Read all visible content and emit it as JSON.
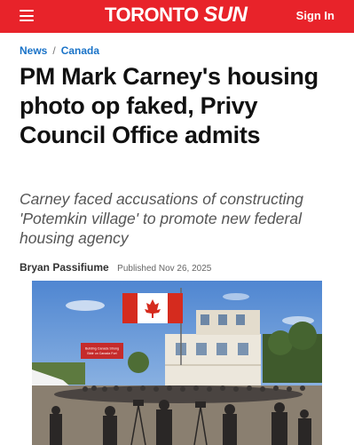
{
  "header": {
    "logo_part1": "TORONTO ",
    "logo_part2": "SUN",
    "signin_label": "Sign In",
    "menu_icon": "hamburger-menu-icon",
    "brand_color": "#e8232a"
  },
  "breadcrumb": {
    "section": "News",
    "separator": "/",
    "subsection": "Canada"
  },
  "article": {
    "headline": "PM Mark Carney's housing photo op faked, Privy Council Office admits",
    "subhead": "Carney faced accusations of constructing 'Potemkin village' to promote new federal housing agency",
    "author": "Bryan Passifiume",
    "published": "Published Nov 26, 2025"
  },
  "photo": {
    "sign_line1": "Building Canada Strong",
    "sign_line2": "Bâtir un Canada Fort"
  }
}
